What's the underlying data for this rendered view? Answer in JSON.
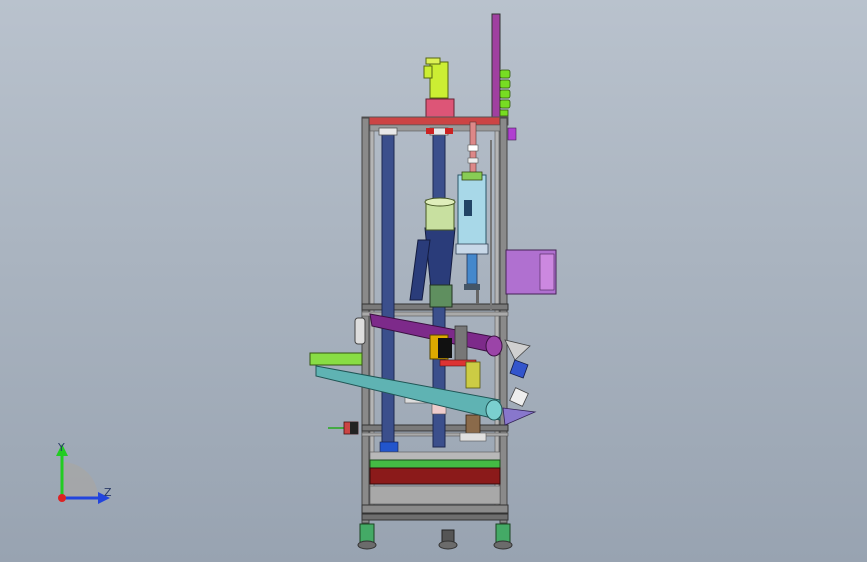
{
  "viewport": {
    "background_top": "#b9c2cd",
    "background_bottom": "#98a3b1"
  },
  "triad": {
    "y_label": "Y",
    "z_label": "Z",
    "y_color": "#22cc22",
    "z_color": "#2244dd",
    "x_color": "#dd2222"
  },
  "colors": {
    "frame": "#7f7f7f",
    "frame_inner": "#a6a6a6",
    "column": "#3b4f8c",
    "hopper_purple": "#7d2a8a",
    "chute_teal": "#5fb3b3",
    "plate_green": "#44bb44",
    "plate_red": "#8b1a1a",
    "motor_green": "#ccee33",
    "motor_pink": "#dd5577",
    "magenta_box": "#b070d0",
    "tower_purple": "#a040a0",
    "tower_green": "#77dd22",
    "navy": "#1f2a5c"
  },
  "icons": {
    "machine": "cad-assembly-icon",
    "triad": "axis-triad-icon"
  }
}
